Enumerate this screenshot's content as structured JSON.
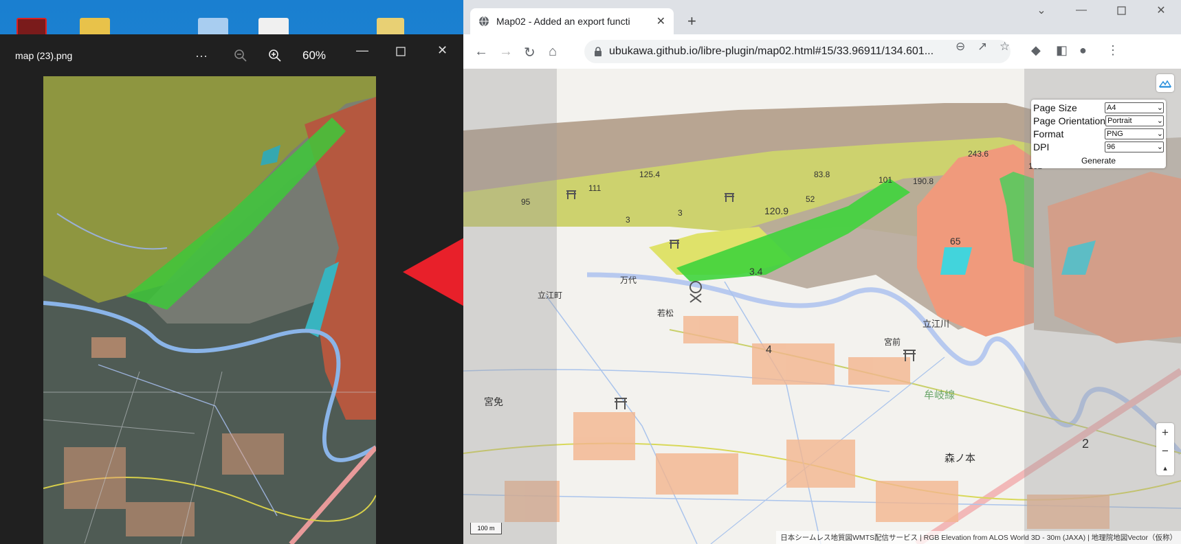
{
  "viewer": {
    "title": "map (23).png",
    "more_icon": "more-icon",
    "zoom_out_icon": "zoom-out-icon",
    "zoom_in_icon": "zoom-in-icon",
    "zoom_level": "60%"
  },
  "browser": {
    "tab_title": "Map02 - Added an export functi",
    "url": "ubukawa.github.io/libre-plugin/map02.html#15/33.96911/134.601...",
    "new_tab_label": "+"
  },
  "export_panel": {
    "rows": [
      {
        "label": "Page Size",
        "value": "A4"
      },
      {
        "label": "Page Orientation",
        "value": "Portrait"
      },
      {
        "label": "Format",
        "value": "PNG"
      },
      {
        "label": "DPI",
        "value": "96"
      }
    ],
    "generate_label": "Generate"
  },
  "map": {
    "scale_label": "100 m",
    "attribution": "日本シームレス地質図WMTS配信サービス | RGB Elevation from ALOS World 3D - 30m (JAXA) | 地理院地図Vector（仮称）",
    "zoom_in_label": "+",
    "zoom_out_label": "−",
    "labels": {
      "l125_4": "125.4",
      "l111": "111",
      "l95": "95",
      "l3a": "3",
      "l3b": "3",
      "l83_8": "83.8",
      "l52": "52",
      "l101": "101",
      "l190_8": "190.8",
      "l243": "243.6",
      "l161": "161",
      "l120_9": "120.9",
      "l65": "65",
      "l3_4": "3.4",
      "l4": "4",
      "l2": "2",
      "tateemachi": "立江町",
      "mandai": "万代",
      "wakamatsu": "若松",
      "tateegawa": "立江川",
      "miyamae": "宮前",
      "mugisen": "牟岐線",
      "miyamen": "宮免",
      "morinomoto": "森ノ本"
    }
  },
  "colors": {
    "arrow": "#e8202a",
    "viewer_bg": "#202020",
    "geology_yellow": "#c8cf5a",
    "geology_green": "#3ccf3c",
    "geology_salmon": "#f08f72",
    "geology_cyan": "#3fd0d8"
  }
}
